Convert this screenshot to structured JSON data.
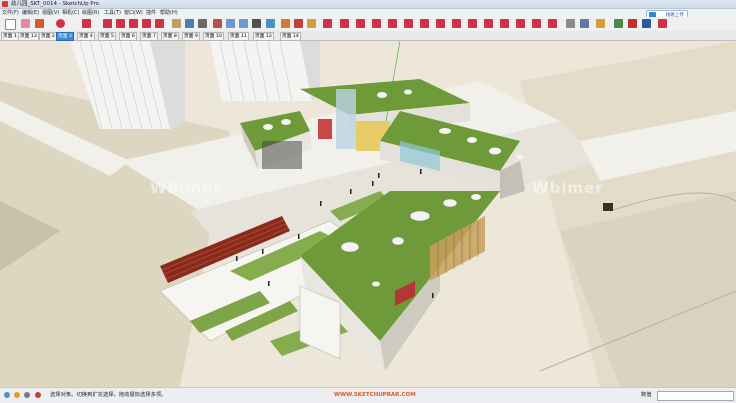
{
  "window": {
    "title": "幼儿园_SKT_0014 - SketchUp Pro"
  },
  "menu": [
    "文件(F)",
    "编辑(E)",
    "视图(V)",
    "相机(C)",
    "绘图(R)",
    "工具(T)",
    "窗口(W)",
    "插件",
    "帮助(H)"
  ],
  "login_label": "线路上传",
  "scene_tabs": [
    "页面 1",
    "页面 13",
    "页面 2",
    "页面 3",
    "页面 4",
    "页面 5",
    "页面 6",
    "页面 7",
    "页面 8",
    "页面 9",
    "页面 10",
    "页面 11",
    "页面 12",
    "页面 14"
  ],
  "active_tab_index": 3,
  "status": {
    "message": "选择对象。切换到扩充选择。拖动鼠标选择多项。",
    "watermark_url": "WWW.SKETCHUPBAR.COM",
    "measure_label": "数值",
    "measure_value": ""
  },
  "viewport_watermark": "Wbimer",
  "colors": {
    "roof_green": "#6f9a3a",
    "track_red": "#8a2a1c",
    "ground": "#ece7d8",
    "active_tab": "#3a8bd8"
  },
  "toolbar_icons": [
    "select-icon",
    "eraser-icon",
    "pencil-icon",
    "arc-icon",
    "rectangle-icon",
    "pushpull-icon",
    "move-icon",
    "rotate-icon",
    "scale-icon",
    "offset-icon",
    "tape-icon",
    "paint-icon",
    "orbit-icon",
    "pan-icon",
    "zoom-icon",
    "zoom-extents-icon",
    "section-icon",
    "component-icon",
    "layer-icon",
    "material-icon",
    "shadow-icon",
    "fog-icon",
    "style-icon",
    "plugin-icon",
    "ruby-icon",
    "su-icon"
  ]
}
